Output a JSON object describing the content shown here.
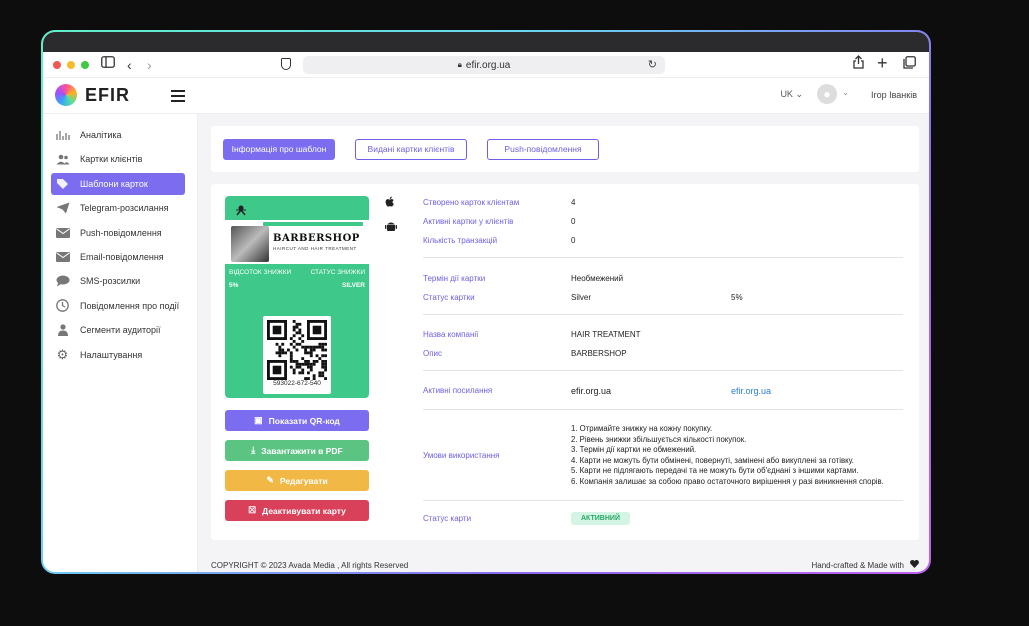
{
  "browser": {
    "url": "efir.org.ua"
  },
  "app": {
    "logo_text": "EFIR",
    "lang": "UK",
    "user_name": "Ігор Іванків"
  },
  "sidebar": {
    "items": [
      {
        "label": "Аналітика",
        "icon": "bar-chart-icon"
      },
      {
        "label": "Картки клієнтів",
        "icon": "users-icon"
      },
      {
        "label": "Шаблони карток",
        "icon": "tag-icon"
      },
      {
        "label": "Telegram-розсилання",
        "icon": "send-icon"
      },
      {
        "label": "Push-повідомлення",
        "icon": "envelope-icon"
      },
      {
        "label": "Email-повідомлення",
        "icon": "envelope-icon"
      },
      {
        "label": "SMS-розсилки",
        "icon": "chat-icon"
      },
      {
        "label": "Повідомлення про події",
        "icon": "clock-icon"
      },
      {
        "label": "Сегменти аудиторії",
        "icon": "user-icon"
      },
      {
        "label": "Налаштування",
        "icon": "gear-icon"
      }
    ],
    "active_index": 2
  },
  "tabs": [
    {
      "label": "Інформація про шаблон",
      "active": true
    },
    {
      "label": "Видані картки клієнтів",
      "active": false
    },
    {
      "label": "Push-повідомлення",
      "active": false
    }
  ],
  "card": {
    "brand": "BARBERSHOP",
    "tagline": "HAIRCUT AND HAIR TREATMENT",
    "discount_label": "ВІДСОТОК ЗНИЖКИ",
    "discount_value": "5%",
    "status_label": "СТАТУС ЗНИЖКИ",
    "status_value": "SILVER",
    "qr_number": "593022-672-540",
    "background_color": "#3ec88a"
  },
  "actions": {
    "show_qr": "Показати QR-код",
    "download_pdf": "Завантажити в PDF",
    "edit": "Редагувати",
    "deactivate": "Деактивувати карту"
  },
  "details": {
    "created_label": "Створено карток клієнтам",
    "created_value": "4",
    "active_label": "Активні картки у клієнтів",
    "active_value": "0",
    "transactions_label": "Кількість транзакцій",
    "transactions_value": "0",
    "validity_label": "Термін дії картки",
    "validity_value": "Необмежений",
    "status_label": "Статус картки",
    "status_value": "Silver",
    "status_percent": "5%",
    "company_label": "Назва компанії",
    "company_value": "HAIR TREATMENT",
    "desc_label": "Опис",
    "desc_value": "BARBERSHOP",
    "links_label": "Активні посилання",
    "links_value": "efir.org.ua",
    "links_url": "efir.org.ua",
    "terms_label": "Умови використання",
    "terms": [
      "1. Отримайте знижку на кожну покупку.",
      "2. Рівень знижки збільшується кількості покупок.",
      "3. Термін дії картки не обмежений.",
      "4. Карти не можуть бути обмінені, повернуті, замінені або викуплені за готівку.",
      "5. Карти не підлягають передачі та не можуть бути об'єднані з іншими картами.",
      "6. Компанія залишає за собою право остаточного вирішення у разі виникнення спорів."
    ],
    "card_status_label": "Статус карти",
    "card_status_value": "АКТИВНИЙ"
  },
  "footer": {
    "copyright": "COPYRIGHT © 2023 Avada Media , All rights Reserved",
    "crafted": "Hand-crafted & Made with"
  },
  "colors": {
    "accent": "#7b6cf0",
    "pdf": "#5cc483",
    "edit": "#f2b845",
    "deactivate": "#d9415a"
  }
}
